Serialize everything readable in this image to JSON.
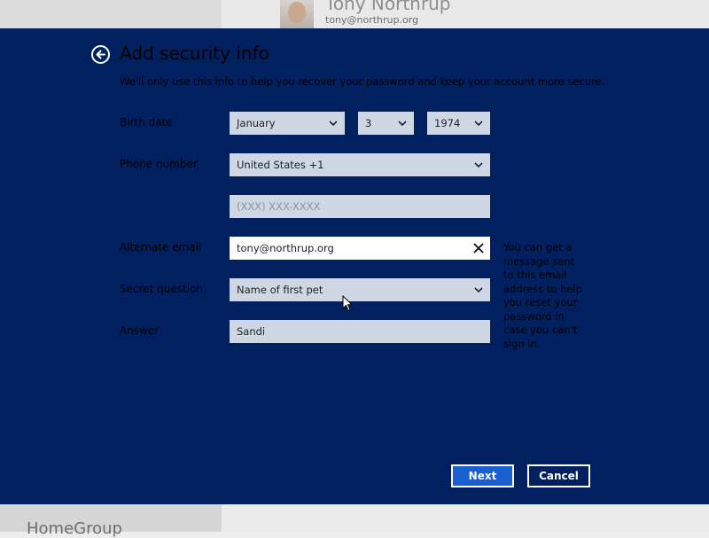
{
  "background": {
    "user_name": "Tony Northrup",
    "user_email": "tony@northrup.org",
    "section_label": "HomeGroup"
  },
  "dialog": {
    "title": "Add security info",
    "subtitle": "We'll only use this info to help you recover your password and keep your account more secure.",
    "birth_date": {
      "label": "Birth date",
      "month": "January",
      "day": "3",
      "year": "1974"
    },
    "phone": {
      "label": "Phone number",
      "country": "United States +1",
      "number_placeholder": "(XXX) XXX-XXXX"
    },
    "alternate_email": {
      "label": "Alternate email",
      "value": "tony@northrup.org"
    },
    "secret_question": {
      "label": "Secret question",
      "value": "Name of first pet"
    },
    "answer": {
      "label": "Answer",
      "value": "Sandi"
    },
    "hint": "You can get a message sent to this email address to help you reset your password in case you can't sign in.",
    "buttons": {
      "next": "Next",
      "cancel": "Cancel"
    }
  },
  "colors": {
    "dialog_bg": "#002060",
    "field_bg": "#cfd6e4",
    "primary_button": "#1a5fd2"
  },
  "icons": [
    "back-arrow-icon",
    "chevron-down-icon",
    "clear-icon",
    "mouse-cursor-icon"
  ]
}
